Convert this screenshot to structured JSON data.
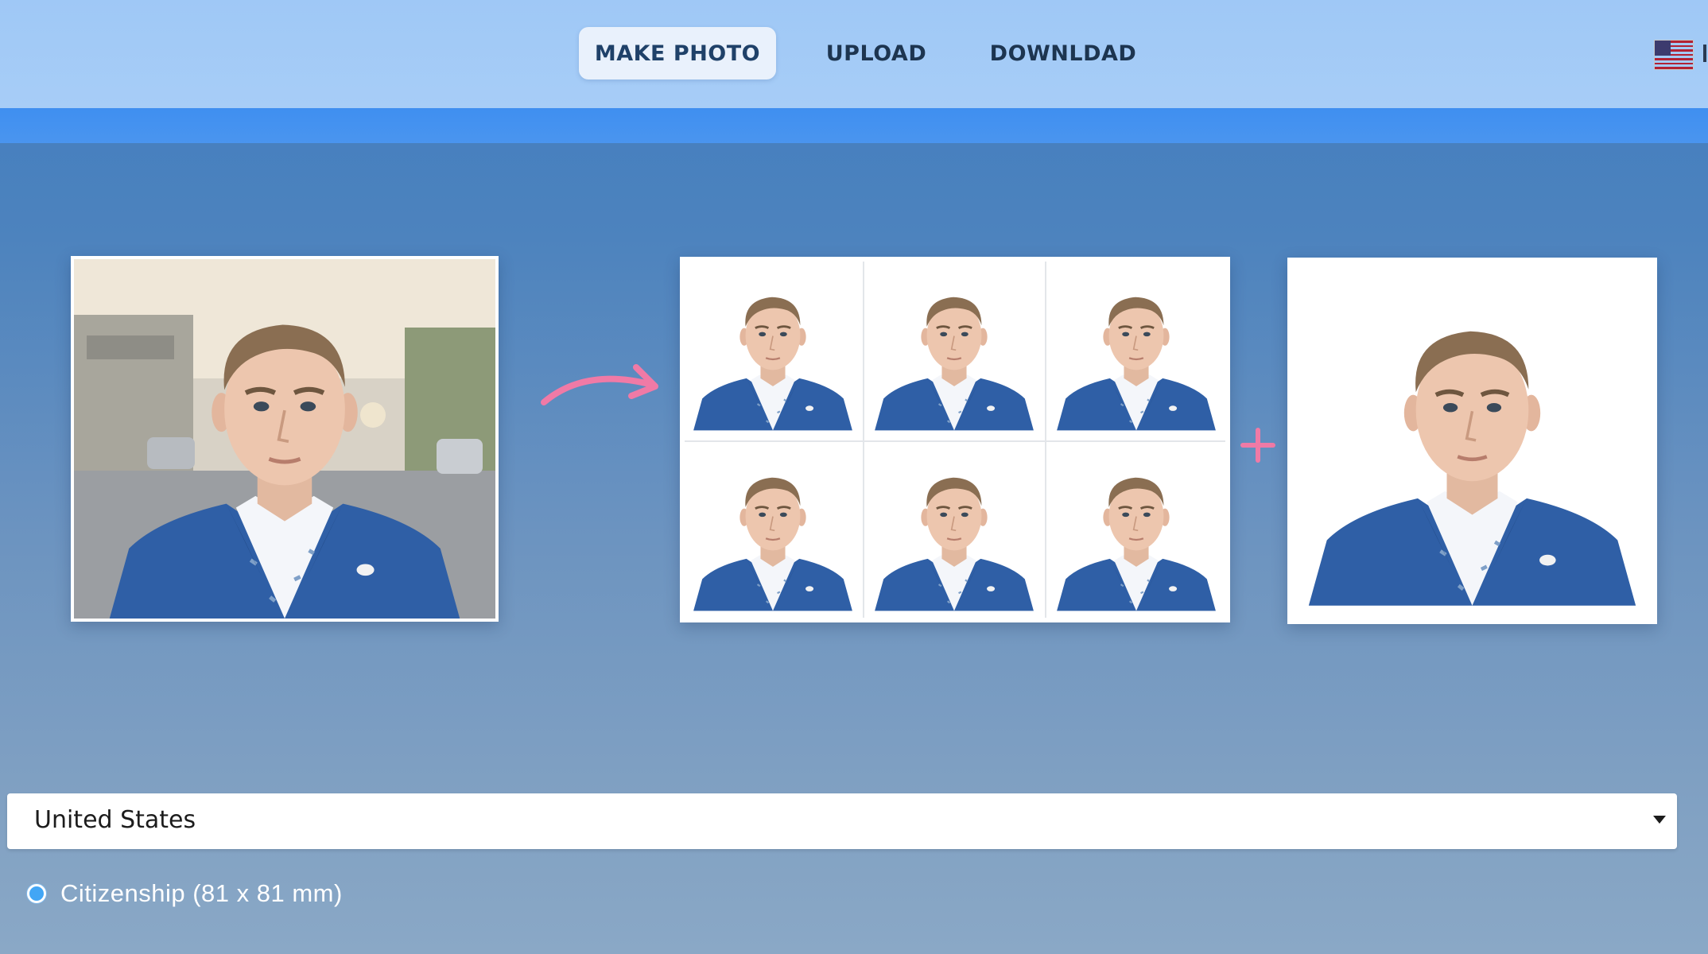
{
  "nav": {
    "items": [
      {
        "label": "MAKE PHOTO",
        "active": true
      },
      {
        "label": "UPLOAD",
        "active": false
      },
      {
        "label": "DOWNLDAD",
        "active": false
      }
    ],
    "language_icon": "us-flag-icon"
  },
  "illustration": {
    "source_photo": "portrait-street-background",
    "sheet_grid": {
      "rows": 2,
      "cols": 3
    },
    "single_photo": "portrait-white-background",
    "arrow_icon": "curved-arrow-icon",
    "plus_icon": "plus-icon",
    "accent_color": "#f07aa6"
  },
  "country_select": {
    "value": "United States",
    "icon": "chevron-down-icon"
  },
  "document_option": {
    "label": "Citizenship (81 x 81 mm)",
    "selected": true
  },
  "colors": {
    "topbar": "#a3caf6",
    "subbar": "#4491ef",
    "background": "#4d83be",
    "jacket": "#2f5fa6"
  }
}
